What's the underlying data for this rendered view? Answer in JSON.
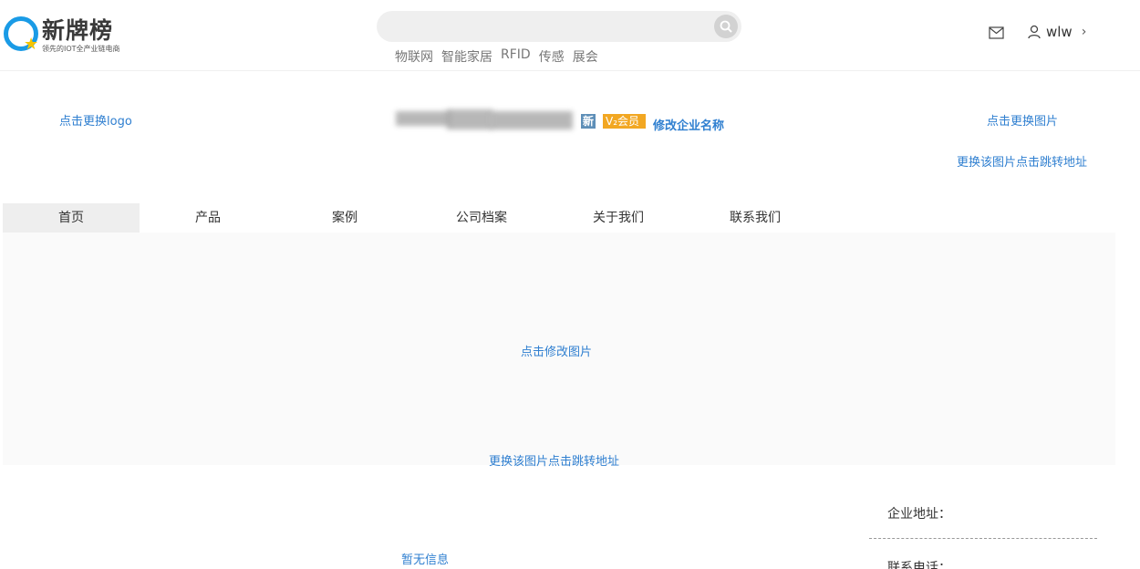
{
  "header": {
    "logo": {
      "name": "新牌榜",
      "slogan": "领先的IOT全产业链电商"
    },
    "search": {
      "placeholder": ""
    },
    "hotwords": [
      "物联网",
      "智能家居",
      "RFID",
      "传感",
      "展会"
    ],
    "user": {
      "name": "wlw",
      "chevron": "›"
    }
  },
  "company": {
    "change_logo": "点击更换logo",
    "badge_new": "新",
    "badge_vip": "V₂会员",
    "edit_name": "修改企业名称",
    "change_image": "点击更换图片",
    "change_image_link": "更换该图片点击跳转地址"
  },
  "nav": {
    "tabs": [
      "首页",
      "产品",
      "案例",
      "公司档案",
      "关于我们",
      "联系我们"
    ],
    "active_index": 0
  },
  "banner": {
    "edit_image": "点击修改图片",
    "change_link": "更换该图片点击跳转地址"
  },
  "content": {
    "empty": "暂无信息"
  },
  "sidebar": {
    "address_label": "企业地址：",
    "phone_label": "联系电话："
  },
  "colors": {
    "link": "#2f7fd0",
    "vip_badge": "#f2a722",
    "new_badge": "#5e8fb8",
    "brand": "#1a9be6"
  }
}
